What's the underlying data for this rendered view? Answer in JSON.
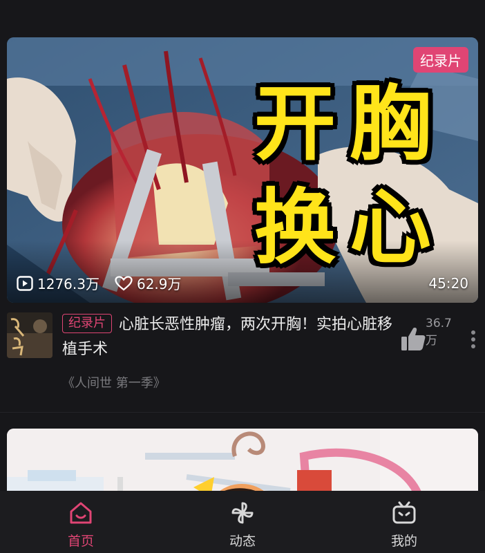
{
  "video": {
    "overlay_title": "开胸\n换心",
    "badge": "纪录片",
    "views": "1276.3万",
    "likes": "62.9万",
    "duration": "45:20"
  },
  "info": {
    "tag": "纪录片",
    "title": "心脏长恶性肿瘤，两次开胸！实拍心脏移植手术",
    "like_count": "36.7万",
    "series": "《人间世 第一季》",
    "avatar_text": "人间世"
  },
  "nav": {
    "items": [
      {
        "label": "首页",
        "icon": "home-icon",
        "active": true
      },
      {
        "label": "动态",
        "icon": "pinwheel-icon",
        "active": false
      },
      {
        "label": "我的",
        "icon": "tv-icon",
        "active": false
      }
    ]
  },
  "colors": {
    "accent": "#e04574",
    "overlay_text": "#ffe41a",
    "background": "#17171a"
  }
}
